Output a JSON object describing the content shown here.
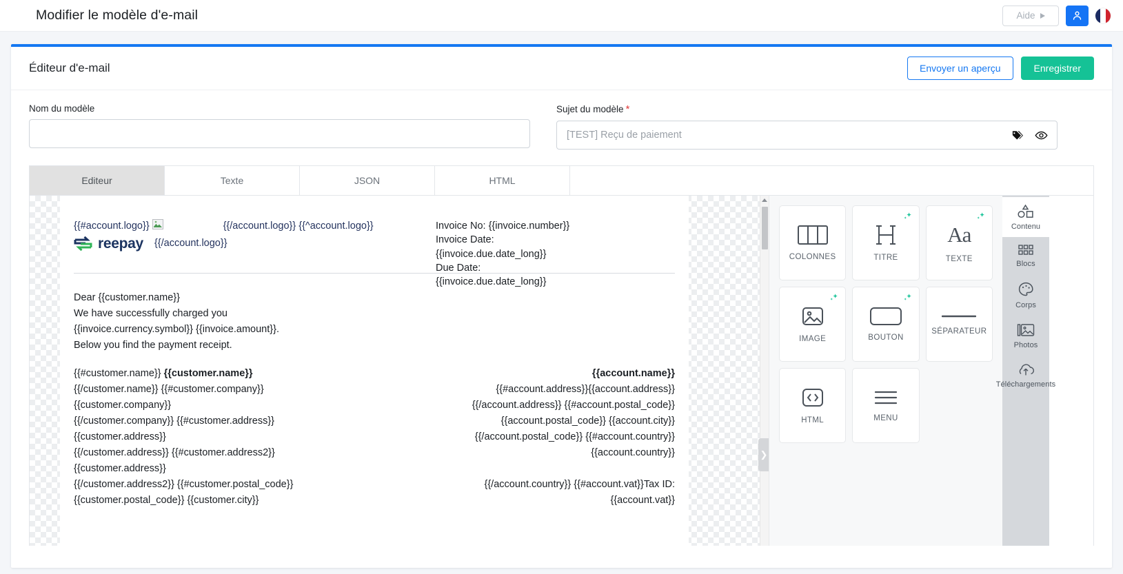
{
  "appbar": {
    "title": "Modifier le modèle d'e-mail",
    "help_label": "Aide",
    "user_icon": "user-icon",
    "flag": "french-flag-icon"
  },
  "editor": {
    "card_title": "Éditeur d'e-mail",
    "preview_button": "Envoyer un aperçu",
    "save_button": "Enregistrer",
    "accent_blue": "#1578f2",
    "accent_green": "#15c296",
    "accent_teal": "#13c296"
  },
  "form": {
    "name_label": "Nom du modèle",
    "name_value": "",
    "name_placeholder": "",
    "subject_label": "Sujet du modèle",
    "subject_required_mark": "*",
    "subject_value": "[TEST] Reçu de paiement",
    "subject_placeholder": "[TEST] Reçu de paiement",
    "tag_icon": "tag-icon",
    "eye_icon": "eye-icon"
  },
  "tabs": [
    {
      "label": "Editeur",
      "active": true
    },
    {
      "label": "Texte",
      "active": false
    },
    {
      "label": "JSON",
      "active": false
    },
    {
      "label": "HTML",
      "active": false
    }
  ],
  "mail": {
    "logo_open": "{{#account.logo}}",
    "logo_close_alt": "{{/account.logo}} {{^account.logo}}",
    "brand_word": "reepay",
    "logo_close": "{{/account.logo}}",
    "invoice_lines": [
      "Invoice No: {{invoice.number}}",
      "Invoice Date:",
      "{{invoice.due.date_long}}",
      "Due Date:",
      "{{invoice.due.date_long}}"
    ],
    "body_lines": [
      "Dear {{customer.name}}",
      "We have successfully charged you",
      "{{invoice.currency.symbol}} {{invoice.amount}}.",
      "Below you find the payment receipt."
    ],
    "customer_lines": [
      "{{#customer.name}} ",
      "{{/customer.name}} {{#customer.company}}",
      "{{customer.company}}",
      "{{/customer.company}} {{#customer.address}}",
      "{{customer.address}}",
      "{{/customer.address}} {{#customer.address2}}",
      "{{customer.address}}",
      "{{/customer.address2}} {{#customer.postal_code}}",
      "{{customer.postal_code}} {{customer.city}}"
    ],
    "customer_name_bold": "{{customer.name}}",
    "account_name_bold": "{{account.name}}",
    "account_lines": [
      "{{#account.address}}{{account.address}}",
      "{{/account.address}} {{#account.postal_code}}",
      "{{account.postal_code}} {{account.city}}",
      "{{/account.postal_code}} {{#account.country}}",
      "{{account.country}}",
      "",
      "{{/account.country}} {{#account.vat}}Tax ID:",
      "{{account.vat}}"
    ]
  },
  "blocks": [
    {
      "label": "COLONNES",
      "icon": "columns-icon",
      "ai": false
    },
    {
      "label": "TITRE",
      "icon": "heading-icon",
      "ai": true
    },
    {
      "label": "TEXTE",
      "icon": "text-icon",
      "ai": true
    },
    {
      "label": "IMAGE",
      "icon": "image-icon",
      "ai": true
    },
    {
      "label": "BOUTON",
      "icon": "button-icon",
      "ai": true
    },
    {
      "label": "SÉPARATEUR",
      "icon": "divider-icon",
      "ai": false
    },
    {
      "label": "HTML",
      "icon": "code-icon",
      "ai": false
    },
    {
      "label": "MENU",
      "icon": "menu-icon",
      "ai": false
    }
  ],
  "rail": [
    {
      "label": "Contenu",
      "icon": "shapes-icon",
      "active": true
    },
    {
      "label": "Blocs",
      "icon": "grid-dots-icon",
      "active": false
    },
    {
      "label": "Corps",
      "icon": "palette-icon",
      "active": false
    },
    {
      "label": "Photos",
      "icon": "photos-icon",
      "active": false
    },
    {
      "label": "Téléchargements",
      "icon": "upload-cloud-icon",
      "active": false
    }
  ]
}
